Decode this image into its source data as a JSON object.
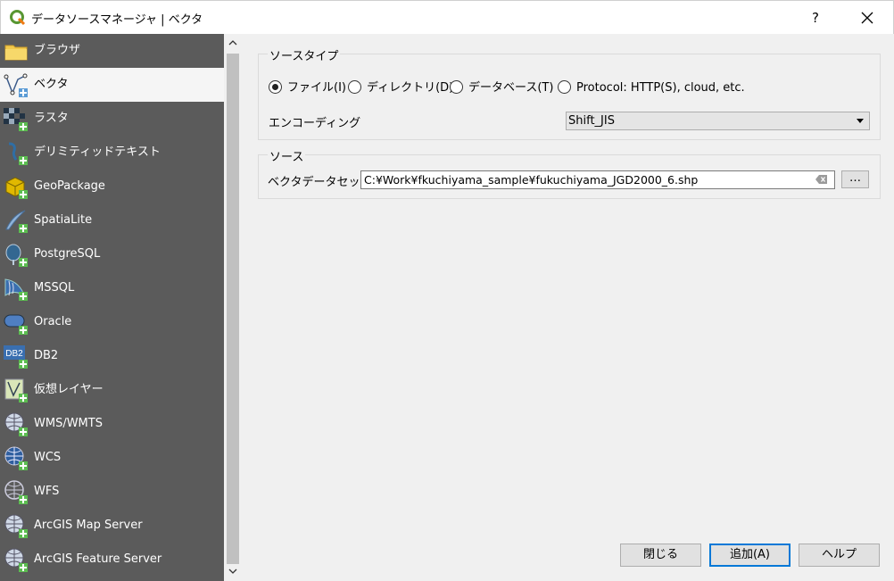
{
  "window": {
    "title": "データソースマネージャ | ベクタ",
    "help_glyph": "?",
    "close_glyph": "✕"
  },
  "sidebar": {
    "items": [
      {
        "label": "ブラウザ",
        "icon": "folder-icon"
      },
      {
        "label": "ベクタ",
        "icon": "vector-icon",
        "selected": true
      },
      {
        "label": "ラスタ",
        "icon": "raster-icon"
      },
      {
        "label": "デリミティッドテキスト",
        "icon": "delimited-text-icon"
      },
      {
        "label": "GeoPackage",
        "icon": "geopackage-icon"
      },
      {
        "label": "SpatiaLite",
        "icon": "spatialite-icon"
      },
      {
        "label": "PostgreSQL",
        "icon": "postgresql-icon"
      },
      {
        "label": "MSSQL",
        "icon": "mssql-icon"
      },
      {
        "label": "Oracle",
        "icon": "oracle-icon"
      },
      {
        "label": "DB2",
        "icon": "db2-icon"
      },
      {
        "label": "仮想レイヤー",
        "icon": "virtual-layer-icon"
      },
      {
        "label": "WMS/WMTS",
        "icon": "wms-icon"
      },
      {
        "label": "WCS",
        "icon": "wcs-icon"
      },
      {
        "label": "WFS",
        "icon": "wfs-icon"
      },
      {
        "label": "ArcGIS Map Server",
        "icon": "arcgis-map-server-icon"
      },
      {
        "label": "ArcGIS Feature Server",
        "icon": "arcgis-feature-server-icon"
      }
    ]
  },
  "source_type": {
    "title": "ソースタイプ",
    "options": [
      {
        "label": "ファイル(I)",
        "selected": true
      },
      {
        "label": "ディレクトリ(D)",
        "selected": false
      },
      {
        "label": "データベース(T)",
        "selected": false
      },
      {
        "label": "Protocol: HTTP(S), cloud, etc.",
        "selected": false
      }
    ],
    "encoding_label": "エンコーディング",
    "encoding_value": "Shift_JIS"
  },
  "source": {
    "title": "ソース",
    "dataset_label": "ベクタデータセット",
    "dataset_value": "C:¥Work¥fkuchiyama_sample¥fukuchiyama_JGD2000_6.shp",
    "browse_label": "…"
  },
  "buttons": {
    "close": "閉じる",
    "add": "追加(A)",
    "help": "ヘルプ"
  }
}
